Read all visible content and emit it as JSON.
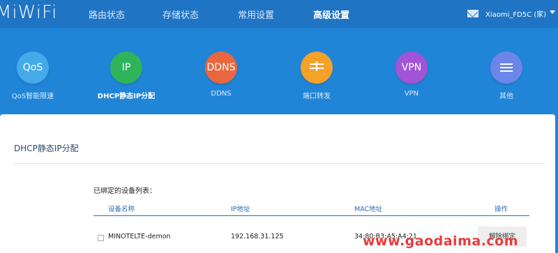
{
  "header": {
    "logo": "MiWiFi",
    "nav": [
      "路由状态",
      "存储状态",
      "常用设置",
      "高级设置"
    ],
    "router_name": "Xiaomi_FD5C (家)"
  },
  "toolbar": {
    "items": [
      {
        "glyph": "QoS",
        "label": "QoS智能限速",
        "color": "#44aaea",
        "icon": "qos-icon"
      },
      {
        "glyph": "IP",
        "label": "DHCP静态IP分配",
        "color": "#2fb45c",
        "icon": "ip-icon"
      },
      {
        "glyph": "DDNS",
        "label": "DDNS",
        "color": "#e8673f",
        "icon": "ddns-icon"
      },
      {
        "glyph": "",
        "label": "端口转发",
        "color": "#f6a127",
        "icon": "port-forward-icon"
      },
      {
        "glyph": "VPN",
        "label": "VPN",
        "color": "#a154d6",
        "icon": "vpn-icon"
      },
      {
        "glyph": "",
        "label": "其他",
        "color": "#6b86e8",
        "icon": "menu-icon"
      }
    ]
  },
  "panel": {
    "title": "DHCP静态IP分配",
    "list_title": "已绑定的设备列表：",
    "columns": [
      "设备名称",
      "IP地址",
      "MAC地址",
      "操作"
    ],
    "rows": [
      {
        "name": "MINOTELTE-demon",
        "ip": "192.168.31.125",
        "mac": "34:80:B3:A5:A4:21",
        "action": "解除绑定"
      }
    ]
  },
  "watermark": "www.gaodaima.com"
}
